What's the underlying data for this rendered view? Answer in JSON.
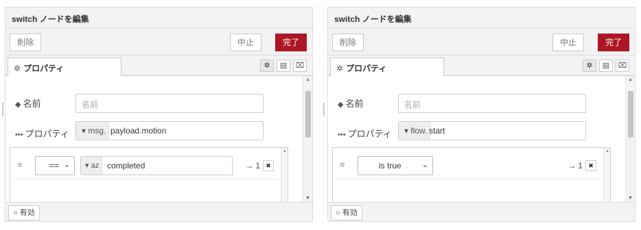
{
  "panels": [
    {
      "title": "switch ノードを編集",
      "delete_label": "削除",
      "cancel_label": "中止",
      "done_label": "完了",
      "tab_label": "プロパティ",
      "name_label": "名前",
      "name_placeholder": "名前",
      "property_label": "プロパティ",
      "property_type": "msg.",
      "property_value": "payload.motion",
      "rule": {
        "operator": "==",
        "value_type_icon": "az",
        "value": "completed",
        "output": "→ 1"
      },
      "enabled_label": "有効"
    },
    {
      "title": "switch ノードを編集",
      "delete_label": "削除",
      "cancel_label": "中止",
      "done_label": "完了",
      "tab_label": "プロパティ",
      "name_label": "名前",
      "name_placeholder": "名前",
      "property_label": "プロパティ",
      "property_type": "flow.",
      "property_value": "start",
      "rule": {
        "operator": "is true",
        "output": "→ 1"
      },
      "enabled_label": "有効"
    }
  ],
  "colors": {
    "primary_button": "#ad1625",
    "header_bg": "#f3f3f3",
    "border": "#dcdcdc"
  },
  "icons": [
    "gear-icon",
    "tag-icon",
    "ellipsis-icon",
    "description-icon",
    "appearance-icon",
    "drag-handle-icon",
    "close-icon",
    "circle-icon"
  ]
}
